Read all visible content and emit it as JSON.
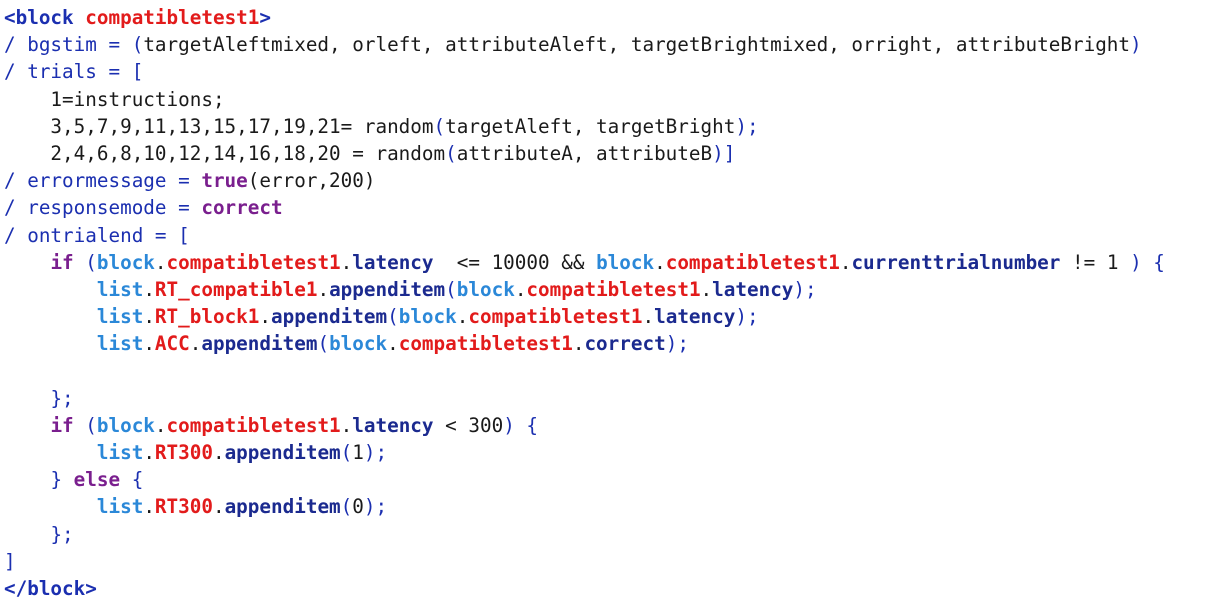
{
  "editor": {
    "language": "Inquisit script",
    "lines": [
      [
        {
          "t": "<block ",
          "c": "tag"
        },
        {
          "t": "compatibletest1",
          "c": "tagname"
        },
        {
          "t": ">",
          "c": "tag"
        }
      ],
      [
        {
          "t": "/ bgstim = ",
          "c": "attr"
        },
        {
          "t": "(",
          "c": "bracket"
        },
        {
          "t": "targetAleftmixed, orleft, attributeAleft, targetBrightmixed, orright, attributeBright",
          "c": "plain"
        },
        {
          "t": ")",
          "c": "bracket"
        }
      ],
      [
        {
          "t": "/ trials = ",
          "c": "attr"
        },
        {
          "t": "[",
          "c": "bracket"
        }
      ],
      [
        {
          "t": "    1=instructions;",
          "c": "plain"
        }
      ],
      [
        {
          "t": "    3,5,7,9,11,13,15,17,19,21= random",
          "c": "plain"
        },
        {
          "t": "(",
          "c": "bracket"
        },
        {
          "t": "targetAleft, targetBright",
          "c": "plain"
        },
        {
          "t": ");",
          "c": "bracket"
        }
      ],
      [
        {
          "t": "    2,4,6,8,10,12,14,16,18,20 = random",
          "c": "plain"
        },
        {
          "t": "(",
          "c": "bracket"
        },
        {
          "t": "attributeA, attributeB",
          "c": "plain"
        },
        {
          "t": ")]",
          "c": "bracket"
        }
      ],
      [
        {
          "t": "/ errormessage = ",
          "c": "attr"
        },
        {
          "t": "true",
          "c": "keyword"
        },
        {
          "t": "(error,200)",
          "c": "plain"
        }
      ],
      [
        {
          "t": "/ responsemode = ",
          "c": "attr"
        },
        {
          "t": "correct",
          "c": "keyword"
        }
      ],
      [
        {
          "t": "/ ontrialend = ",
          "c": "attr"
        },
        {
          "t": "[",
          "c": "bracket"
        }
      ],
      [
        {
          "t": "    ",
          "c": "plain"
        },
        {
          "t": "if",
          "c": "keyword"
        },
        {
          "t": " ",
          "c": "plain"
        },
        {
          "t": "(",
          "c": "bracket"
        },
        {
          "t": "block",
          "c": "object"
        },
        {
          "t": ".",
          "c": "punct"
        },
        {
          "t": "compatibletest1",
          "c": "name"
        },
        {
          "t": ".",
          "c": "punct"
        },
        {
          "t": "latency",
          "c": "member"
        },
        {
          "t": "  <= 10000 && ",
          "c": "plain"
        },
        {
          "t": "block",
          "c": "object"
        },
        {
          "t": ".",
          "c": "punct"
        },
        {
          "t": "compatibletest1",
          "c": "name"
        },
        {
          "t": ".",
          "c": "punct"
        },
        {
          "t": "currenttrialnumber",
          "c": "member"
        },
        {
          "t": " != 1 ",
          "c": "plain"
        },
        {
          "t": ")",
          "c": "bracket"
        },
        {
          "t": " ",
          "c": "plain"
        },
        {
          "t": "{",
          "c": "bracket"
        }
      ],
      [
        {
          "t": "        ",
          "c": "plain"
        },
        {
          "t": "list",
          "c": "object"
        },
        {
          "t": ".",
          "c": "punct"
        },
        {
          "t": "RT_compatible1",
          "c": "name"
        },
        {
          "t": ".",
          "c": "punct"
        },
        {
          "t": "appenditem",
          "c": "member"
        },
        {
          "t": "(",
          "c": "bracket"
        },
        {
          "t": "block",
          "c": "object"
        },
        {
          "t": ".",
          "c": "punct"
        },
        {
          "t": "compatibletest1",
          "c": "name"
        },
        {
          "t": ".",
          "c": "punct"
        },
        {
          "t": "latency",
          "c": "member"
        },
        {
          "t": ");",
          "c": "bracket"
        }
      ],
      [
        {
          "t": "        ",
          "c": "plain"
        },
        {
          "t": "list",
          "c": "object"
        },
        {
          "t": ".",
          "c": "punct"
        },
        {
          "t": "RT_block1",
          "c": "name"
        },
        {
          "t": ".",
          "c": "punct"
        },
        {
          "t": "appenditem",
          "c": "member"
        },
        {
          "t": "(",
          "c": "bracket"
        },
        {
          "t": "block",
          "c": "object"
        },
        {
          "t": ".",
          "c": "punct"
        },
        {
          "t": "compatibletest1",
          "c": "name"
        },
        {
          "t": ".",
          "c": "punct"
        },
        {
          "t": "latency",
          "c": "member"
        },
        {
          "t": ");",
          "c": "bracket"
        }
      ],
      [
        {
          "t": "        ",
          "c": "plain"
        },
        {
          "t": "list",
          "c": "object"
        },
        {
          "t": ".",
          "c": "punct"
        },
        {
          "t": "ACC",
          "c": "name"
        },
        {
          "t": ".",
          "c": "punct"
        },
        {
          "t": "appenditem",
          "c": "member"
        },
        {
          "t": "(",
          "c": "bracket"
        },
        {
          "t": "block",
          "c": "object"
        },
        {
          "t": ".",
          "c": "punct"
        },
        {
          "t": "compatibletest1",
          "c": "name"
        },
        {
          "t": ".",
          "c": "punct"
        },
        {
          "t": "correct",
          "c": "member"
        },
        {
          "t": ");",
          "c": "bracket"
        }
      ],
      [],
      [
        {
          "t": "    ",
          "c": "plain"
        },
        {
          "t": "};",
          "c": "bracket"
        }
      ],
      [
        {
          "t": "    ",
          "c": "plain"
        },
        {
          "t": "if",
          "c": "keyword"
        },
        {
          "t": " ",
          "c": "plain"
        },
        {
          "t": "(",
          "c": "bracket"
        },
        {
          "t": "block",
          "c": "object"
        },
        {
          "t": ".",
          "c": "punct"
        },
        {
          "t": "compatibletest1",
          "c": "name"
        },
        {
          "t": ".",
          "c": "punct"
        },
        {
          "t": "latency",
          "c": "member"
        },
        {
          "t": " < 300",
          "c": "plain"
        },
        {
          "t": ")",
          "c": "bracket"
        },
        {
          "t": " ",
          "c": "plain"
        },
        {
          "t": "{",
          "c": "bracket"
        }
      ],
      [
        {
          "t": "        ",
          "c": "plain"
        },
        {
          "t": "list",
          "c": "object"
        },
        {
          "t": ".",
          "c": "punct"
        },
        {
          "t": "RT300",
          "c": "name"
        },
        {
          "t": ".",
          "c": "punct"
        },
        {
          "t": "appenditem",
          "c": "member"
        },
        {
          "t": "(",
          "c": "bracket"
        },
        {
          "t": "1",
          "c": "plain"
        },
        {
          "t": ");",
          "c": "bracket"
        }
      ],
      [
        {
          "t": "    ",
          "c": "plain"
        },
        {
          "t": "}",
          "c": "bracket"
        },
        {
          "t": " ",
          "c": "plain"
        },
        {
          "t": "else",
          "c": "keyword"
        },
        {
          "t": " ",
          "c": "plain"
        },
        {
          "t": "{",
          "c": "bracket"
        }
      ],
      [
        {
          "t": "        ",
          "c": "plain"
        },
        {
          "t": "list",
          "c": "object"
        },
        {
          "t": ".",
          "c": "punct"
        },
        {
          "t": "RT300",
          "c": "name"
        },
        {
          "t": ".",
          "c": "punct"
        },
        {
          "t": "appenditem",
          "c": "member"
        },
        {
          "t": "(",
          "c": "bracket"
        },
        {
          "t": "0",
          "c": "plain"
        },
        {
          "t": ");",
          "c": "bracket"
        }
      ],
      [
        {
          "t": "    ",
          "c": "plain"
        },
        {
          "t": "};",
          "c": "bracket"
        }
      ],
      [
        {
          "t": "]",
          "c": "bracket"
        }
      ],
      [
        {
          "t": "</block>",
          "c": "tag"
        }
      ]
    ]
  }
}
